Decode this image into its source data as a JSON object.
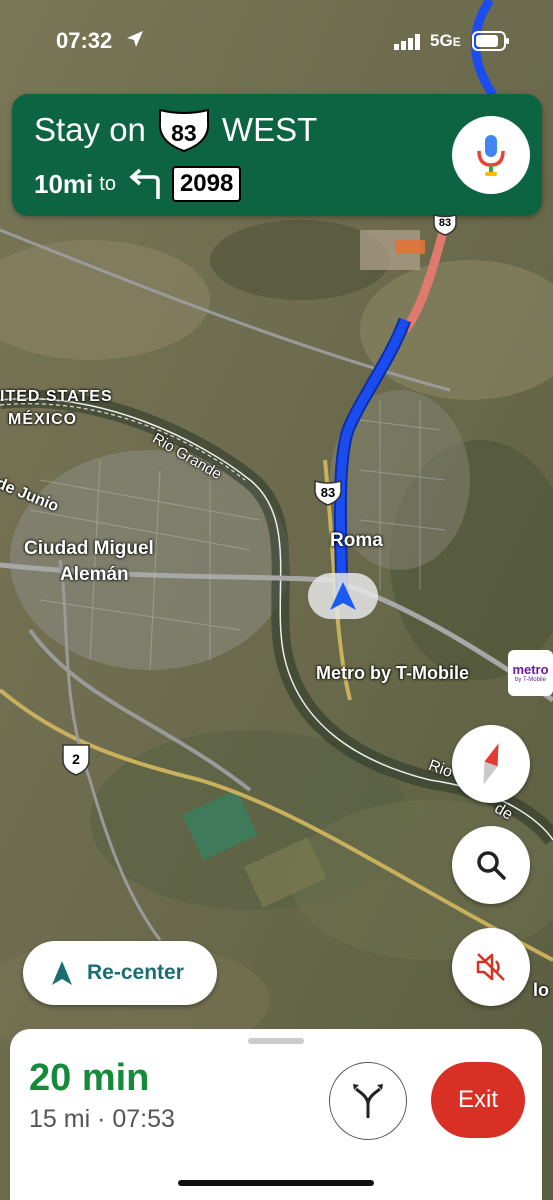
{
  "status_bar": {
    "time": "07:32",
    "network": "5G",
    "network_suffix": "E"
  },
  "navigation": {
    "instruction_prefix": "Stay on",
    "route_number": "83",
    "direction": "WEST",
    "distance": "10mi",
    "to_word": "to",
    "next_road": "2098"
  },
  "map": {
    "labels": {
      "united_states": "ITED STATES",
      "mexico": "MÉXICO",
      "rio_grande_1": "Rio Grande",
      "rio_grande_2": "Rio",
      "rio_grande_3": "de",
      "de_junio": "de Junio",
      "city_line1": "Ciudad Miguel",
      "city_line2": "Alemán",
      "roma": "Roma",
      "metro_place": "Metro by T-Mobile",
      "metro_logo": "metro",
      "metro_logo_small": "by T-Mobile",
      "edge_text": "lo",
      "route_shield_top": "83",
      "route_shield_mid": "83",
      "mex_route": "2"
    }
  },
  "buttons": {
    "recenter_label": "Re-center",
    "exit_label": "Exit"
  },
  "trip": {
    "duration": "20 min",
    "detail": "15 mi · 07:53"
  },
  "colors": {
    "nav_green": "#0d6443",
    "route_blue": "#1a4cf0",
    "eta_green": "#168a3b",
    "exit_red": "#d93025"
  },
  "icons": [
    "location-arrow-icon",
    "signal-icon",
    "battery-icon",
    "turn-left-icon",
    "microphone-icon",
    "compass-icon",
    "search-icon",
    "mute-icon",
    "navigation-arrow-icon",
    "alternate-routes-icon"
  ]
}
